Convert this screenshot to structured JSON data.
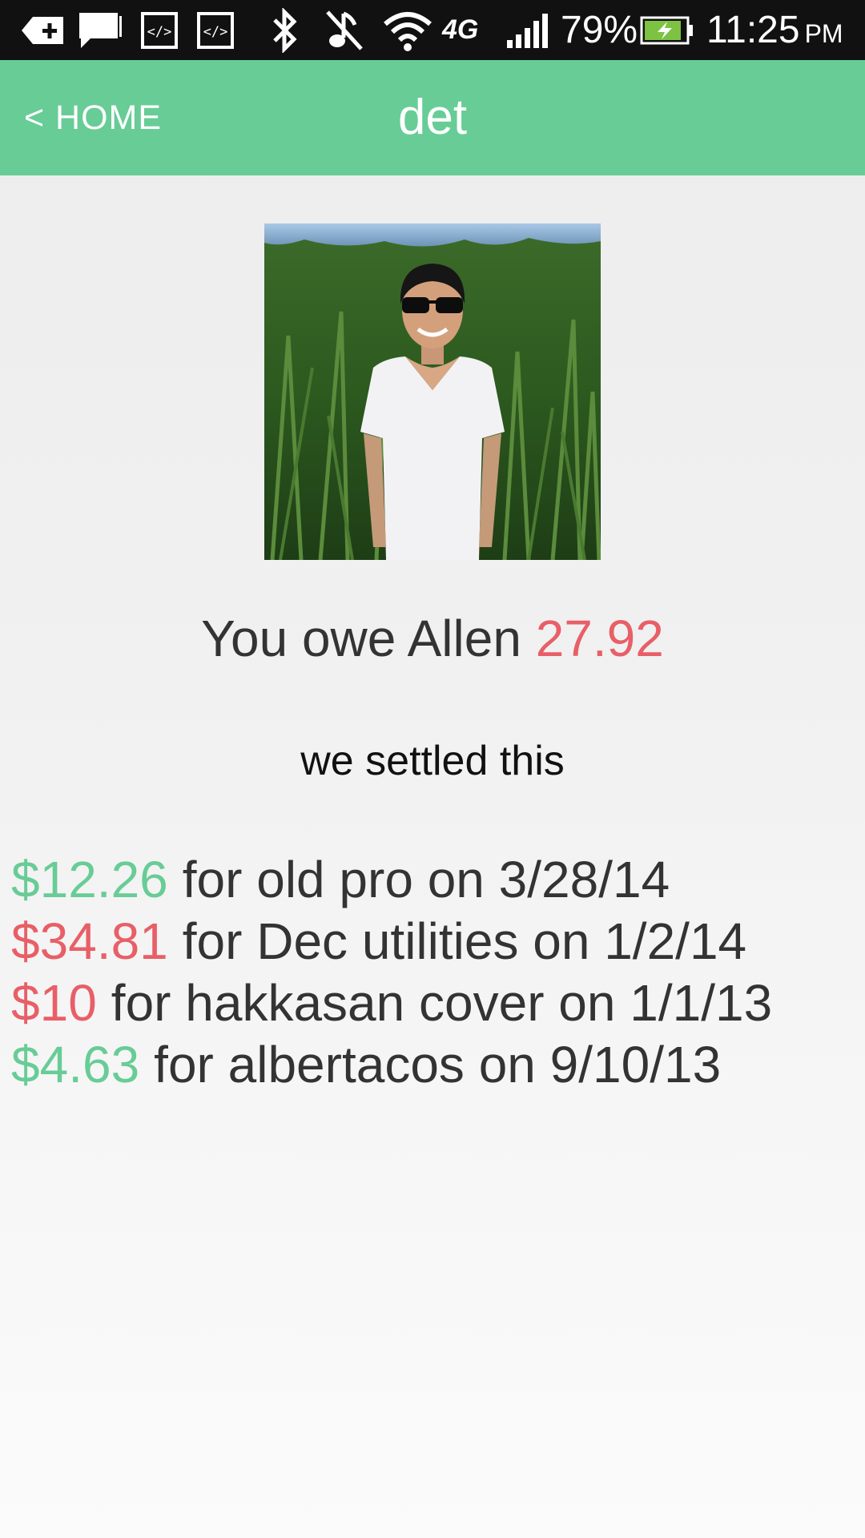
{
  "status_bar": {
    "icons": [
      "add-notification-icon",
      "message-icon",
      "code-icon",
      "code-icon",
      "bluetooth-icon",
      "vibrate-off-icon",
      "wifi-icon",
      "4g-icon",
      "signal-icon",
      "battery-charging-icon"
    ],
    "network_label": "4G",
    "battery": "79%",
    "time": "11:25",
    "ampm": "PM"
  },
  "header": {
    "back_label": "< HOME",
    "title": "det"
  },
  "balance": {
    "prefix": "You owe Allen",
    "amount": "27.92"
  },
  "settle": {
    "label": "we settled this"
  },
  "transactions": [
    {
      "amount": "$12.26",
      "description": "for old pro on 3/28/14",
      "direction": "positive"
    },
    {
      "amount": "$34.81",
      "description": "for Dec utilities on 1/2/14",
      "direction": "negative"
    },
    {
      "amount": "$10",
      "description": "for hakkasan cover on 1/1/13",
      "direction": "negative"
    },
    {
      "amount": "$4.63",
      "description": "for albertacos on 9/10/13",
      "direction": "positive"
    }
  ],
  "colors": {
    "accent": "#68cc96",
    "owed": "#e85f67",
    "text": "#333333",
    "status_bar": "#111111"
  }
}
